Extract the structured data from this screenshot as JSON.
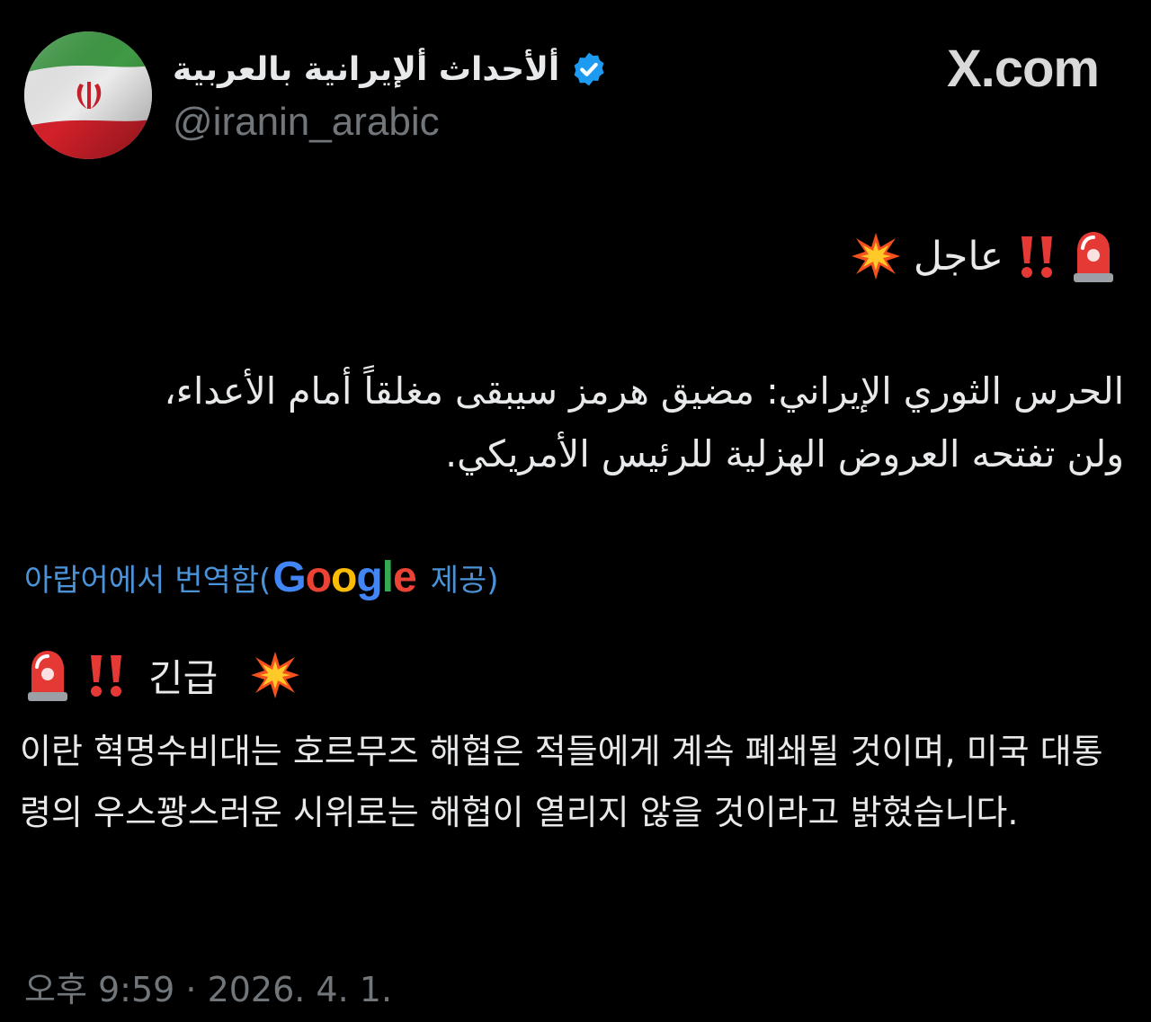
{
  "header": {
    "display_name": "ألأحداث ألإيرانية بالعربية",
    "handle": "@iranin_arabic",
    "verified": true,
    "site_brand": "X.com",
    "avatar": "iran-flag-avatar"
  },
  "original_post": {
    "urgent_word": "عاجل",
    "icons": [
      "police-siren-icon",
      "double-exclamation-icon",
      "collision-icon"
    ],
    "body": "الحرس الثوري الإيراني: مضيق هرمز سيبقى مغلقاً أمام الأعداء، ولن تفتحه العروض الهزلية للرئيس الأمريكي."
  },
  "translation": {
    "prefix": "아랍어에서 번역함(",
    "google_logo": {
      "letters": [
        "G",
        "o",
        "o",
        "g",
        "l",
        "e"
      ],
      "colors": [
        "#4285F4",
        "#EA4335",
        "#FBBC05",
        "#4285F4",
        "#34A853",
        "#EA4335"
      ]
    },
    "suffix": "제공)",
    "urgent_word": "긴급",
    "body": "이란 혁명수비대는 호르무즈 해협은 적들에게 계속 폐쇄될 것이며, 미국 대통령의 우스꽝스러운 시위로는 해협이 열리지 않을 것이라고 밝혔습니다."
  },
  "timestamp": "오후 9:59 · 2026. 4. 1.",
  "colors": {
    "background": "#000000",
    "text_primary": "#e7e9ea",
    "text_secondary": "#71767b",
    "link": "#4b93d9",
    "verified_blue": "#1d9bf0"
  }
}
